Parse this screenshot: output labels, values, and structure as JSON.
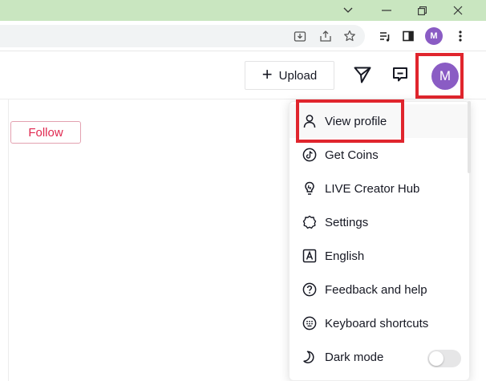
{
  "window": {
    "controls": [
      "chevron-down-icon",
      "minimize-icon",
      "restore-icon",
      "close-icon"
    ]
  },
  "browser": {
    "avatar_initial": "M",
    "toolbar_icons": [
      "download-icon",
      "share-icon",
      "star-icon",
      "playlist-icon",
      "sidepanel-icon",
      "kebab-menu-icon"
    ]
  },
  "header": {
    "upload_label": "Upload",
    "upload_icon": "plus-icon",
    "avatar_initial": "M",
    "icons": [
      "send-icon",
      "inbox-icon"
    ]
  },
  "content": {
    "follow_label": "Follow"
  },
  "menu": {
    "items": [
      {
        "label": "View profile",
        "icon": "person-icon"
      },
      {
        "label": "Get Coins",
        "icon": "coin-icon"
      },
      {
        "label": "LIVE Creator Hub",
        "icon": "lightbulb-icon"
      },
      {
        "label": "Settings",
        "icon": "gear-icon"
      },
      {
        "label": "English",
        "icon": "language-icon"
      },
      {
        "label": "Feedback and help",
        "icon": "help-icon"
      },
      {
        "label": "Keyboard shortcuts",
        "icon": "keyboard-icon"
      },
      {
        "label": "Dark mode",
        "icon": "moon-icon",
        "toggle_on": false
      }
    ]
  },
  "colors": {
    "titlebar": "#c9e6c0",
    "avatar": "#8a5cc4",
    "highlight": "#e0252d",
    "follow": "#e0284f"
  }
}
